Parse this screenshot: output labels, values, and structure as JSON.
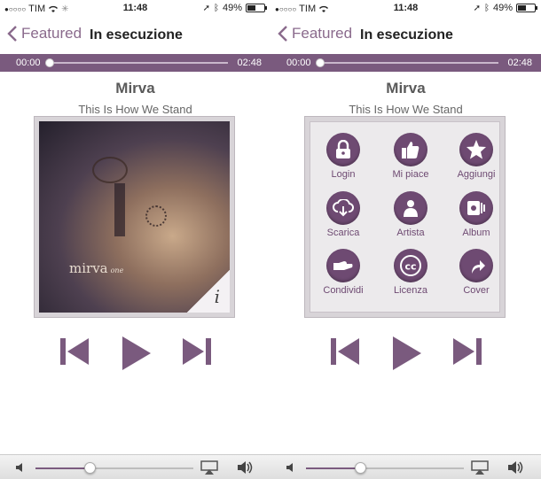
{
  "colors": {
    "accent": "#7a5a7e",
    "menu_icon": "#6e4a72",
    "back_link": "#8a6a8c"
  },
  "status": {
    "carrier": "TIM",
    "time": "11:48",
    "battery_label": "49%",
    "battery_level": 0.49
  },
  "nav": {
    "back_label": "Featured",
    "title": "In esecuzione"
  },
  "player": {
    "current_time": "00:00",
    "total_time": "02:48",
    "progress": 0.0
  },
  "track": {
    "artist": "Mirva",
    "song": "This Is How We Stand"
  },
  "cover": {
    "artist_text": "mirva",
    "album_suffix": "one",
    "info_glyph": "i"
  },
  "menu_items": [
    {
      "label": "Login",
      "icon": "lock-icon"
    },
    {
      "label": "Mi piace",
      "icon": "thumbs-up-icon"
    },
    {
      "label": "Aggiungi",
      "icon": "star-icon"
    },
    {
      "label": "Scarica",
      "icon": "cloud-download-icon"
    },
    {
      "label": "Artista",
      "icon": "person-icon"
    },
    {
      "label": "Album",
      "icon": "album-icon"
    },
    {
      "label": "Condividi",
      "icon": "share-hand-icon"
    },
    {
      "label": "Licenza",
      "icon": "cc-license-icon"
    },
    {
      "label": "Cover",
      "icon": "cover-arrow-icon"
    }
  ],
  "volume": {
    "level": 0.34
  }
}
